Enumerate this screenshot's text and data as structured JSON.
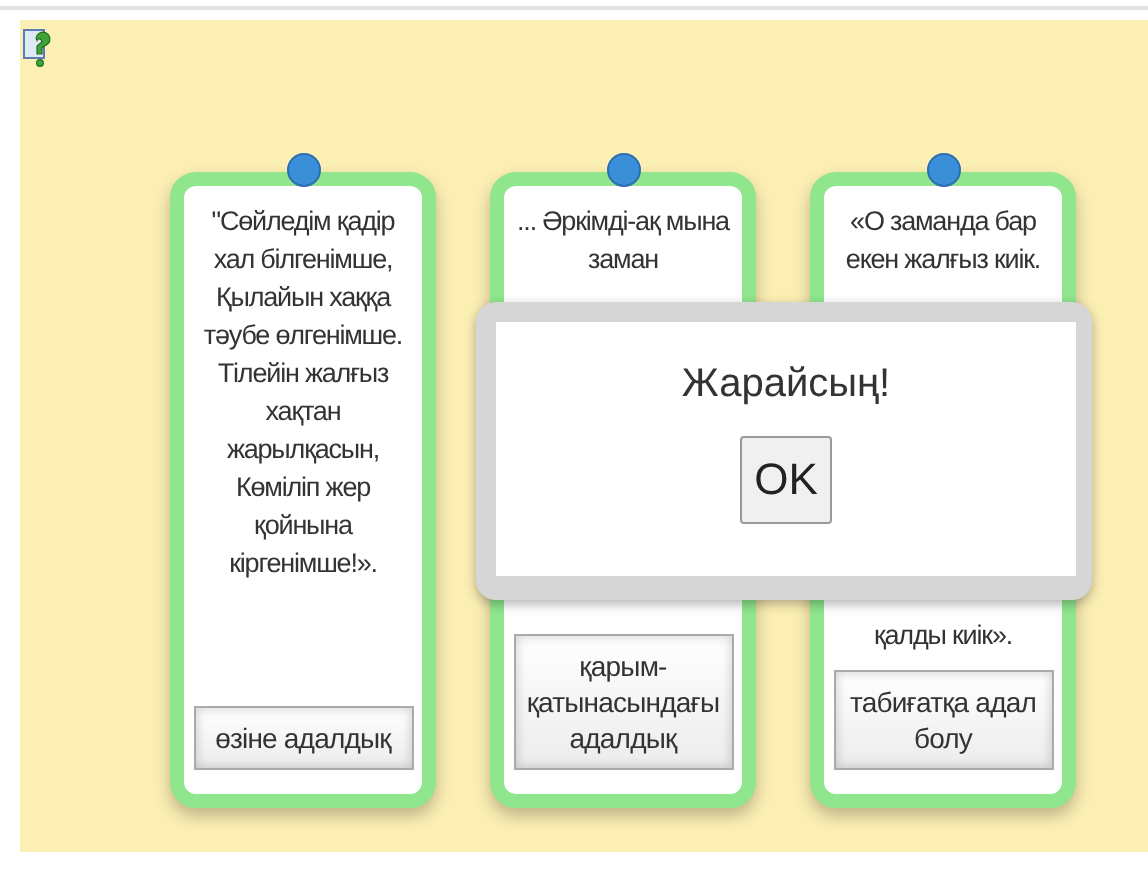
{
  "cards": [
    {
      "texts": [
        "\"Сөйледім қадір хал білгенімше, Қылайын хаққа тәубе өлгенімше. Тілейін жалғыз хақтан жарылқасын, Көміліп жер қойнына кіргенімше!»."
      ],
      "button": "өзіне адалдық"
    },
    {
      "texts": [
        "... Әркімді-ақ мына заман"
      ],
      "button": "қарым-қатынасындағы адалдық"
    },
    {
      "texts": [
        "«О заманда бар екен жалғыз киік.",
        "қалды киік»."
      ],
      "button": "табиғатқа адал болу"
    }
  ],
  "dialog": {
    "message": "Жарайсың!",
    "button": "OK"
  }
}
